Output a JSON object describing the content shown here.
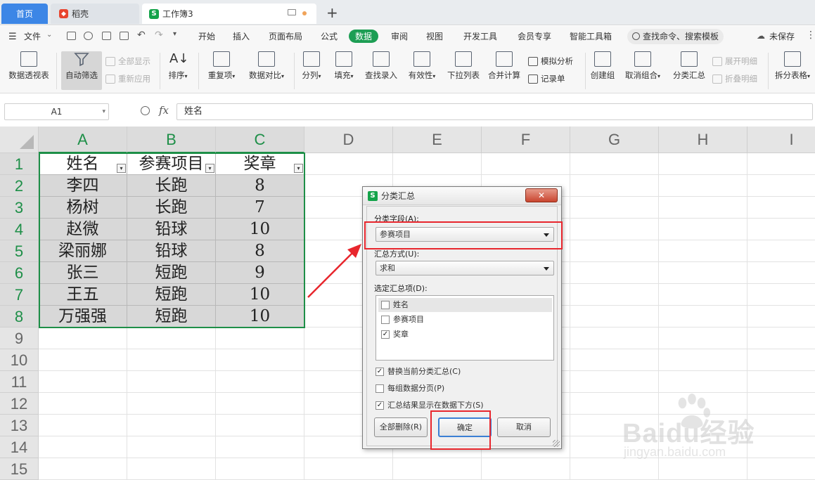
{
  "tabs": {
    "home": "首页",
    "daoke": "稻壳",
    "workbook": "工作簿3",
    "new_tab": "+"
  },
  "menu": {
    "file": "文件",
    "items": [
      "开始",
      "插入",
      "页面布局",
      "公式",
      "数据",
      "审阅",
      "视图",
      "开发工具",
      "会员专享",
      "智能工具箱"
    ],
    "active": "数据",
    "search": "查找命令、搜索模板",
    "unsaved": "未保存"
  },
  "ribbon": {
    "pivot": "数据透视表",
    "autofilter": "自动筛选",
    "show_all": "全部显示",
    "reapply": "重新应用",
    "sort": "排序",
    "duplicates": "重复项",
    "compare": "数据对比",
    "split_col": "分列",
    "fill": "填充",
    "lookup_entry": "查找录入",
    "validity": "有效性",
    "dropdown": "下拉列表",
    "merge_calc": "合并计算",
    "simulate": "模拟分析",
    "record": "记录单",
    "create_group": "创建组",
    "ungroup": "取消组合",
    "subtotal": "分类汇总",
    "expand": "展开明细",
    "collapse": "折叠明细",
    "split_table": "拆分表格"
  },
  "formula": {
    "name_box": "A1",
    "fx": "fx",
    "content": "姓名"
  },
  "columns": [
    "A",
    "B",
    "C",
    "D",
    "E",
    "F",
    "G",
    "H",
    "I"
  ],
  "rows": [
    "1",
    "2",
    "3",
    "4",
    "5",
    "6",
    "7",
    "8",
    "9",
    "10",
    "11",
    "12",
    "13",
    "14",
    "15"
  ],
  "table": {
    "headers": [
      "姓名",
      "参赛项目",
      "奖章"
    ],
    "rows": [
      [
        "李四",
        "长跑",
        "8"
      ],
      [
        "杨树",
        "长跑",
        "7"
      ],
      [
        "赵微",
        "铅球",
        "10"
      ],
      [
        "梁丽娜",
        "铅球",
        "8"
      ],
      [
        "张三",
        "短跑",
        "9"
      ],
      [
        "王五",
        "短跑",
        "10"
      ],
      [
        "万强强",
        "短跑",
        "10"
      ]
    ]
  },
  "dialog": {
    "title": "分类汇总",
    "close": "✕",
    "group_field_label": "分类字段(A):",
    "group_field_value": "参赛项目",
    "method_label": "汇总方式(U):",
    "method_value": "求和",
    "items_label": "选定汇总项(D):",
    "items": [
      {
        "label": "姓名",
        "checked": false
      },
      {
        "label": "参赛项目",
        "checked": false
      },
      {
        "label": "奖章",
        "checked": true
      }
    ],
    "options": [
      {
        "label": "替换当前分类汇总(C)",
        "checked": true
      },
      {
        "label": "每组数据分页(P)",
        "checked": false
      },
      {
        "label": "汇总结果显示在数据下方(S)",
        "checked": true
      }
    ],
    "btn_delete_all": "全部删除(R)",
    "btn_ok": "确定",
    "btn_cancel": "取消"
  },
  "watermark": {
    "brand": "Baidu经验",
    "url": "jingyan.baidu.com"
  },
  "colors": {
    "accent_green": "#1e8f48",
    "highlight_red": "#e8262d",
    "tab_blue": "#3c86e6"
  }
}
